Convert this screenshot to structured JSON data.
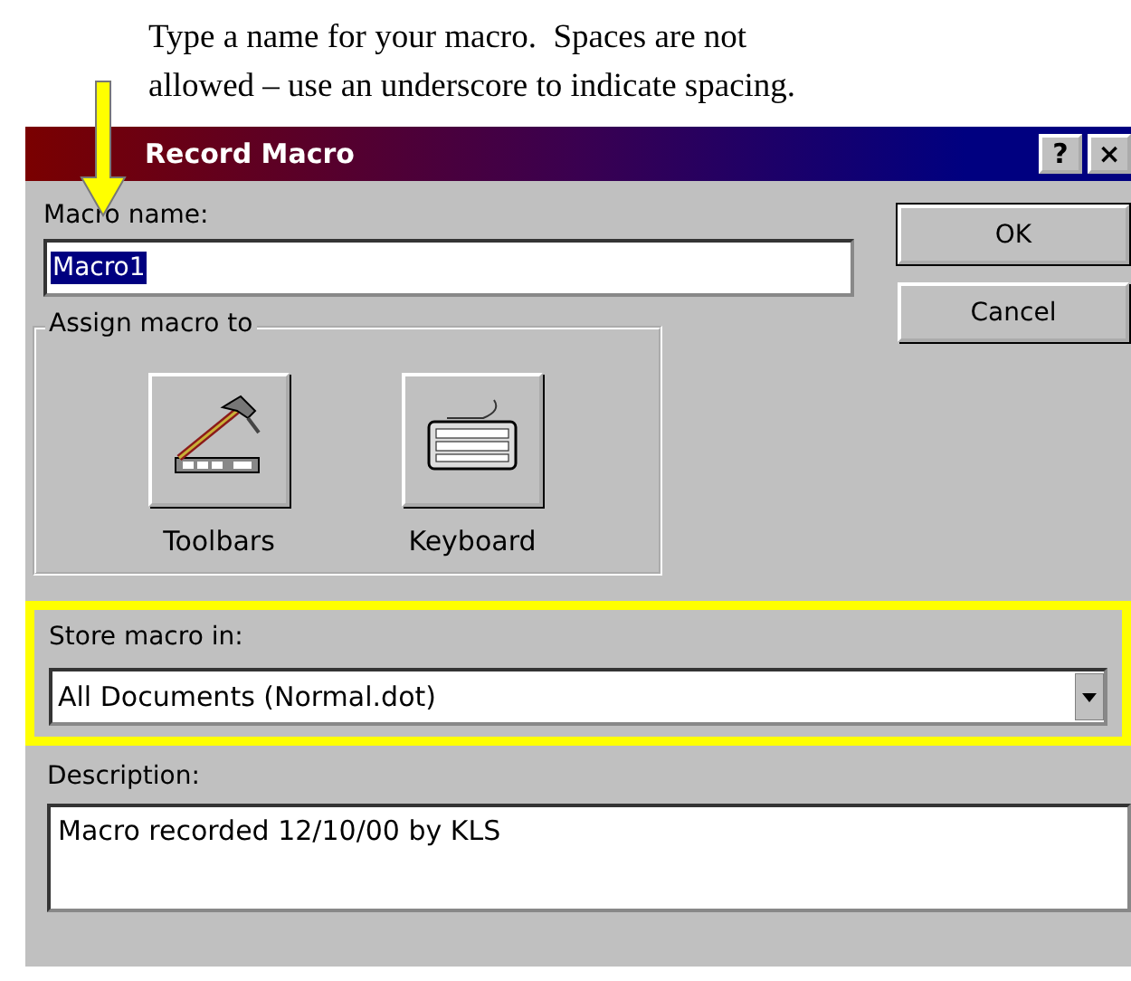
{
  "annotation": {
    "text": "Type a name for your macro.  Spaces are not allowed – use an underscore to indicate spacing."
  },
  "window": {
    "title": "Record Macro",
    "title_buttons": [
      "?",
      "×"
    ]
  },
  "macro_name": {
    "label": "Macro name:",
    "value": "Macro1"
  },
  "buttons": [
    "OK",
    "Cancel"
  ],
  "assign_group": {
    "label": "Assign macro to",
    "items": [
      {
        "kind": "toolbars",
        "label": "Toolbars"
      },
      {
        "kind": "keyboard",
        "label": "Keyboard"
      }
    ]
  },
  "store_in": {
    "label": "Store macro in:",
    "value": "All Documents (Normal.dot)",
    "highlighted": true
  },
  "description": {
    "label": "Description:",
    "value": "Macro recorded 12/10/00 by KLS"
  }
}
